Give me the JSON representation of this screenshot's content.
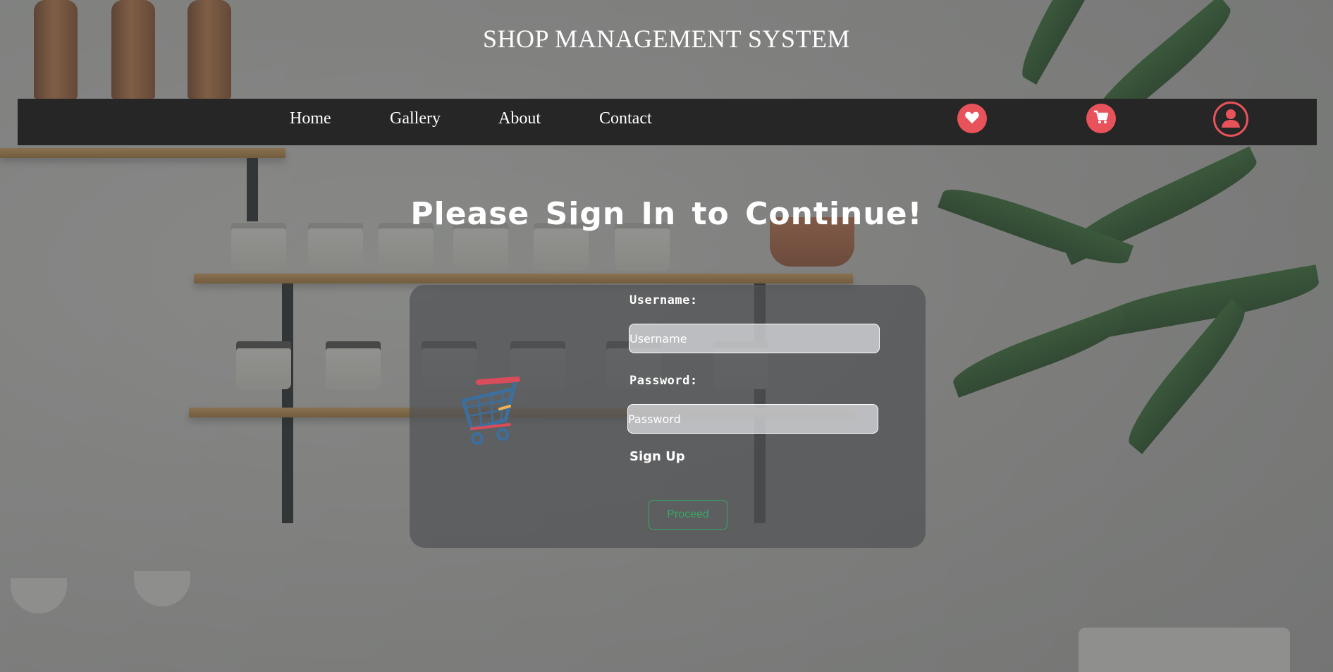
{
  "header": {
    "title": "SHOP MANAGEMENT SYSTEM"
  },
  "nav": {
    "links": [
      "Home",
      "Gallery",
      "About",
      "Contact"
    ],
    "icons": [
      "heart-icon",
      "cart-icon",
      "user-icon"
    ]
  },
  "main": {
    "heading": "Please Sign In to Continue!",
    "username_label": "Username:",
    "username_placeholder": "Username",
    "username_value": "",
    "password_label": "Password:",
    "password_placeholder": "Password",
    "password_value": "",
    "signup_label": "Sign Up",
    "proceed_label": "Proceed"
  },
  "colors": {
    "navbar": "#262626",
    "accent": "#e8525a",
    "proceed": "#3aa466"
  }
}
